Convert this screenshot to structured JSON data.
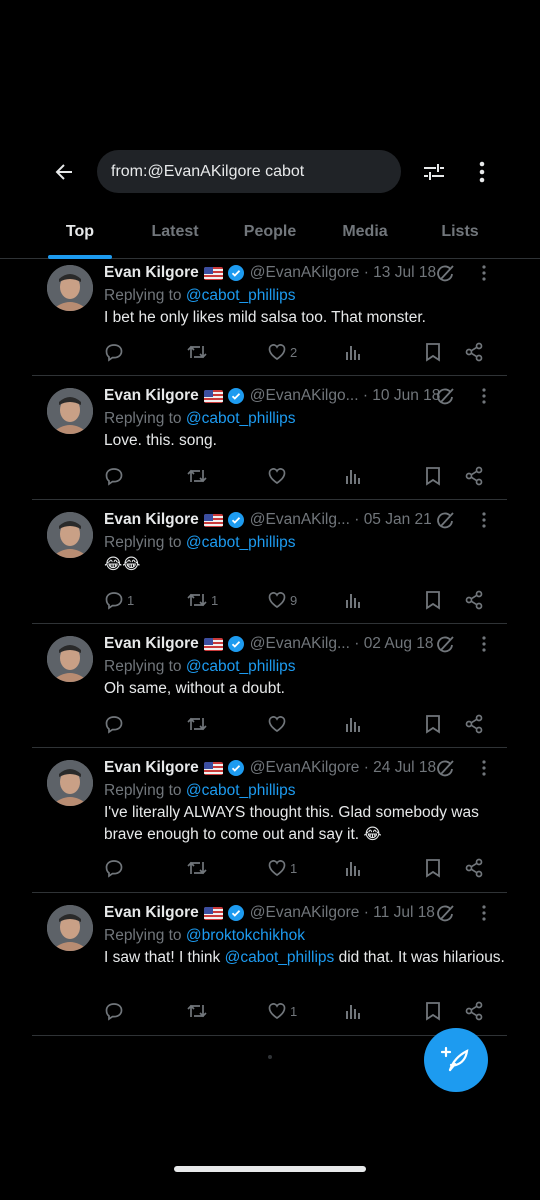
{
  "search": {
    "query": "from:@EvanAKilgore cabot"
  },
  "tabs": [
    {
      "label": "Top"
    },
    {
      "label": "Latest"
    },
    {
      "label": "People"
    },
    {
      "label": "Media"
    },
    {
      "label": "Lists"
    }
  ],
  "tweets": [
    {
      "name": "Evan Kilgore",
      "handle": "@EvanAKilgore · 13 Jul 18",
      "reply_prefix": "Replying to ",
      "reply_to": "@cabot_phillips",
      "text": "I bet he only likes mild salsa too. That monster.",
      "replies": "",
      "retweets": "",
      "likes": "2"
    },
    {
      "name": "Evan Kilgore",
      "handle": "@EvanAKilgo... · 10 Jun 18",
      "reply_prefix": "Replying to ",
      "reply_to": "@cabot_phillips",
      "text": "Love. this. song.",
      "replies": "",
      "retweets": "",
      "likes": ""
    },
    {
      "name": "Evan Kilgore",
      "handle": "@EvanAKilg... · 05 Jan 21",
      "reply_prefix": "Replying to ",
      "reply_to": "@cabot_phillips",
      "text": "😂😂",
      "replies": "1",
      "retweets": "1",
      "likes": "9"
    },
    {
      "name": "Evan Kilgore",
      "handle": "@EvanAKilg... · 02 Aug 18",
      "reply_prefix": "Replying to ",
      "reply_to": "@cabot_phillips",
      "text": "Oh same, without a doubt.",
      "replies": "",
      "retweets": "",
      "likes": ""
    },
    {
      "name": "Evan Kilgore",
      "handle": "@EvanAKilgore · 24 Jul 18",
      "reply_prefix": "Replying to ",
      "reply_to": "@cabot_phillips",
      "text": "I've literally ALWAYS thought this. Glad somebody was brave enough to come out and say it. 😂",
      "replies": "",
      "retweets": "",
      "likes": "1"
    },
    {
      "name": "Evan Kilgore",
      "handle": "@EvanAKilgore · 11 Jul 18",
      "reply_prefix": "Replying to ",
      "reply_to": "@broktokchikhok",
      "text_before": "I saw that! I think ",
      "text_mention": "@cabot_phillips",
      "text_after": " did that. It was hilarious.",
      "replies": "",
      "retweets": "",
      "likes": "1"
    }
  ],
  "colors": {
    "accent": "#1d9bf0",
    "muted": "#71767b",
    "background": "#000000",
    "divider": "#2f3336"
  },
  "icons": [
    "back-arrow-icon",
    "filter-icon",
    "more-vert-icon",
    "verified-badge-icon",
    "grok-icon",
    "reply-icon",
    "retweet-icon",
    "like-icon",
    "views-icon",
    "bookmark-icon",
    "share-icon",
    "compose-icon"
  ]
}
